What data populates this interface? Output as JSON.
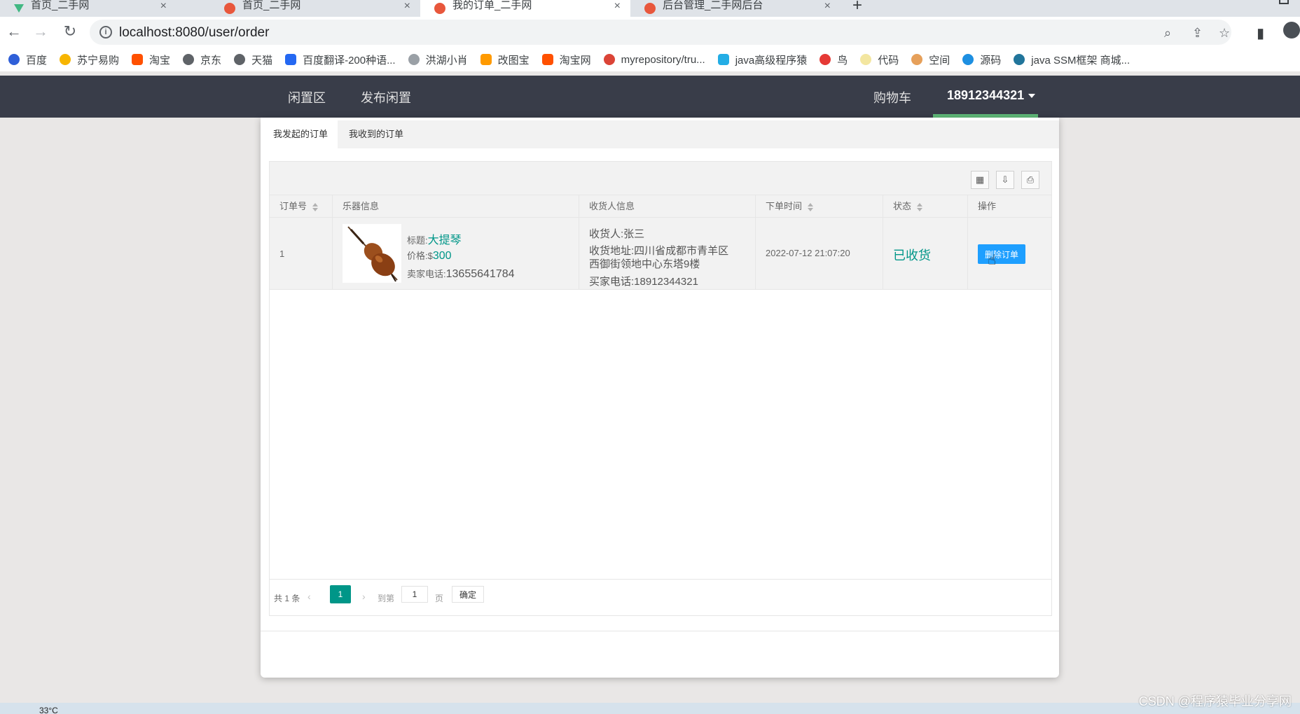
{
  "browser": {
    "tabs": [
      {
        "title": "首页_二手网",
        "favicon": "vue-icon"
      },
      {
        "title": "首页_二手网",
        "favicon": "red-circle-icon"
      },
      {
        "title": "我的订单_二手网",
        "favicon": "red-circle-icon"
      },
      {
        "title": "后台管理_二手网后台",
        "favicon": "red-circle-icon"
      }
    ],
    "url": "localhost:8080/user/order",
    "bookmarks": [
      "百度",
      "苏宁易购",
      "淘宝",
      "京东",
      "天猫",
      "百度翻译-200种语...",
      "洪湖小肖",
      "改图宝",
      "淘宝网",
      "myrepository/tru...",
      "java高级程序猿",
      "鸟",
      "代码",
      "空间",
      "源码",
      "java SSM框架 商城..."
    ]
  },
  "header": {
    "nav": [
      "闲置区",
      "发布闲置"
    ],
    "cart": "购物车",
    "user": "18912344321"
  },
  "tabs": {
    "sent": "我发起的订单",
    "received": "我收到的订单"
  },
  "table": {
    "columns": {
      "order_no": "订单号",
      "instrument": "乐器信息",
      "receiver": "收货人信息",
      "time": "下单时间",
      "status": "状态",
      "action": "操作"
    },
    "rows": [
      {
        "order_no": "1",
        "title_label": "标题:",
        "title": "大提琴",
        "price_label": "价格:",
        "price_currency": "$",
        "price": "300",
        "seller_phone_label": "卖家电话:",
        "seller_phone": "13655641784",
        "receiver": "收货人:张三",
        "address": "收货地址:四川省成都市青羊区西御街领地中心东塔9楼",
        "buyer_phone": "买家电话:18912344321",
        "time": "2022-07-12 21:07:20",
        "status": "已收货",
        "action": "删除订单"
      }
    ]
  },
  "pager": {
    "total": "共 1 条",
    "current": "1",
    "goto": "到第",
    "page_input": "1",
    "page_unit": "页",
    "confirm": "确定"
  },
  "taskbar": {
    "weather": "33°C"
  },
  "watermark": "CSDN @程序猿毕业分享网",
  "colors": {
    "header_bg": "#393d49",
    "accent_green": "#009688",
    "button_blue": "#1e9fff",
    "underline_green": "#5fb878"
  }
}
